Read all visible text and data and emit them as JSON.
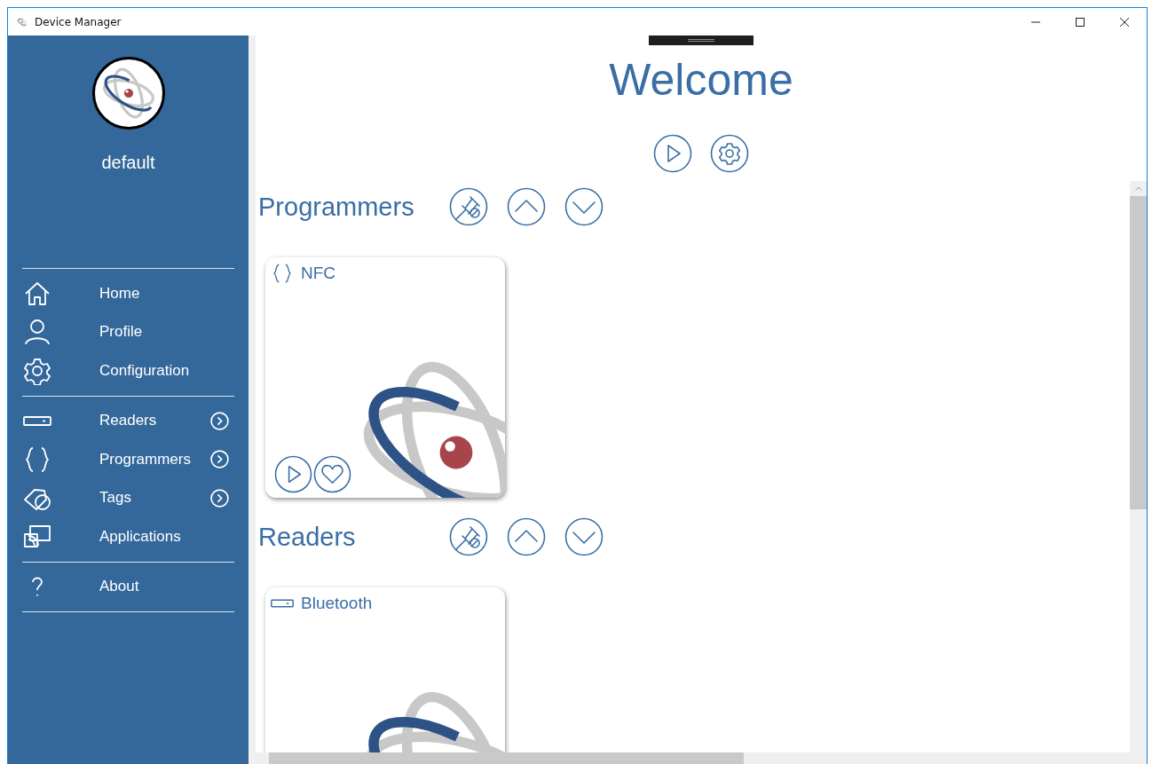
{
  "window": {
    "title": "Device Manager"
  },
  "sidebar": {
    "profile_name": "default",
    "groups": [
      [
        {
          "label": "Home",
          "has_submenu": false
        },
        {
          "label": "Profile",
          "has_submenu": false
        },
        {
          "label": "Configuration",
          "has_submenu": false
        }
      ],
      [
        {
          "label": "Readers",
          "has_submenu": true
        },
        {
          "label": "Programmers",
          "has_submenu": true
        },
        {
          "label": "Tags",
          "has_submenu": true
        },
        {
          "label": "Applications",
          "has_submenu": false
        }
      ],
      [
        {
          "label": "About",
          "has_submenu": false
        }
      ]
    ]
  },
  "main": {
    "title": "Welcome"
  },
  "sections": [
    {
      "title": "Programmers",
      "cards": [
        {
          "title": "NFC"
        }
      ]
    },
    {
      "title": "Readers",
      "cards": [
        {
          "title": "Bluetooth"
        }
      ]
    }
  ]
}
